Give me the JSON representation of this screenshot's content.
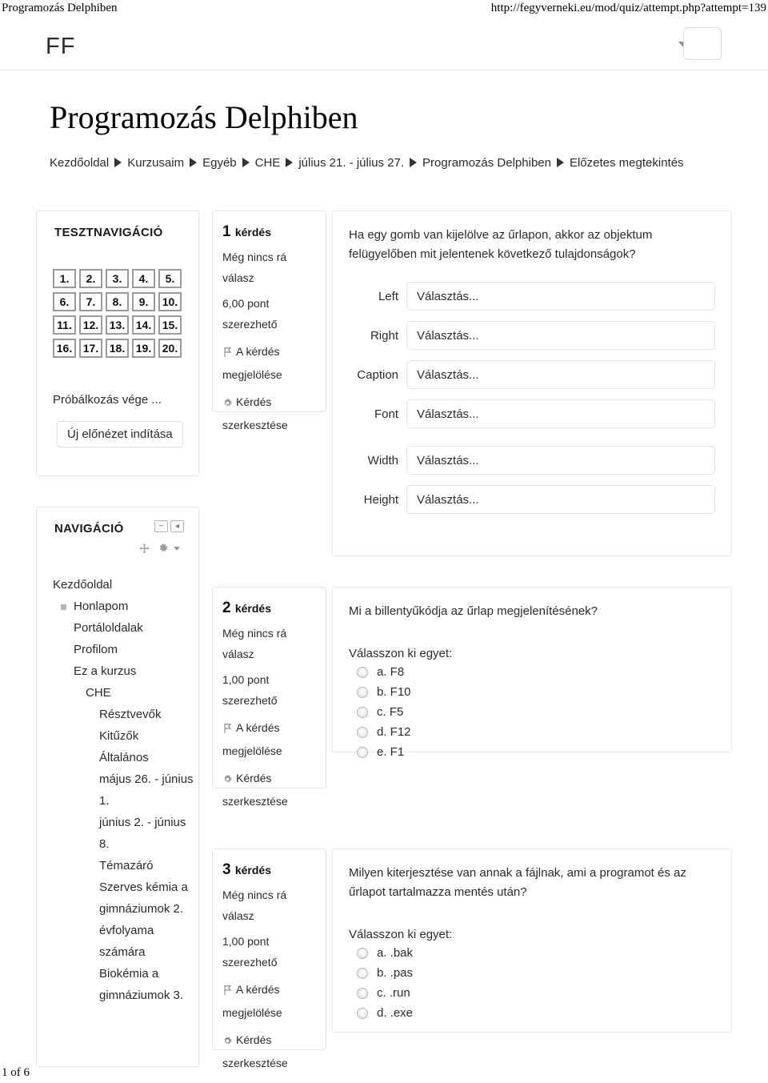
{
  "print_header": {
    "left": "Programozás Delphiben",
    "right": "http://fegyverneki.eu/mod/quiz/attempt.php?attempt=139"
  },
  "topbar": {
    "logo": "FF",
    "caret_icon": "chevron-down-icon",
    "blank_button_label": ""
  },
  "page_title": "Programozás Delphiben",
  "breadcrumb": {
    "items": [
      "Kezdőoldal",
      "Kurzusaim",
      "Egyéb",
      "CHE",
      "július 21. - július 27.",
      "Programozás Delphiben",
      "Előzetes megtekintés"
    ]
  },
  "quiz_nav": {
    "title": "TESZTNAVIGÁCIÓ",
    "boxes": [
      [
        "1.",
        "2.",
        "3.",
        "4.",
        "5."
      ],
      [
        "6.",
        "7.",
        "8.",
        "9.",
        "10."
      ],
      [
        "11.",
        "12.",
        "13.",
        "14.",
        "15."
      ],
      [
        "16.",
        "17.",
        "18.",
        "19.",
        "20."
      ]
    ],
    "attempt_end": "Próbálkozás vége ...",
    "new_preview_button": "Új előnézet indítása"
  },
  "nav_block": {
    "title": "NAVIGÁCIÓ",
    "header_icons": [
      "minimize-icon",
      "dock-left-icon"
    ],
    "tool_icons": [
      "move-icon",
      "gear-icon",
      "chevron-down-icon"
    ],
    "items": [
      {
        "label": "Kezdőoldal",
        "level": 0,
        "bullet": false
      },
      {
        "label": "Honlapom",
        "level": 1,
        "bullet": true
      },
      {
        "label": "Portáloldalak",
        "level": 1,
        "bullet": false
      },
      {
        "label": "Profilom",
        "level": 1,
        "bullet": false
      },
      {
        "label": "Ez a kurzus",
        "level": 1,
        "bullet": false
      },
      {
        "label": "CHE",
        "level": 2,
        "bullet": false
      },
      {
        "label": "Résztvevők",
        "level": 3,
        "bullet": false
      },
      {
        "label": "Kitűzők",
        "level": 3,
        "bullet": false
      },
      {
        "label": "Általános",
        "level": 3,
        "bullet": false
      },
      {
        "label": "május 26. - június 1.",
        "level": 3,
        "bullet": false
      },
      {
        "label": "június 2. - június 8.",
        "level": 3,
        "bullet": false
      },
      {
        "label": "Témazáró",
        "level": 3,
        "bullet": false
      },
      {
        "label": "Szerves kémia a gimnáziumok 2. évfolyama számára",
        "level": 3,
        "bullet": false
      },
      {
        "label": "Biokémia a gimnáziumok 3.",
        "level": 3,
        "bullet": false
      }
    ]
  },
  "questions": [
    {
      "number": "1",
      "number_suffix": "kérdés",
      "status": "Még nincs rá válasz",
      "points": "6,00 pont szerezhető",
      "flag_link": "A kérdés megjelölése",
      "edit_link": "Kérdés szerkesztése",
      "text": "Ha egy gomb van kijelölve az űrlapon, akkor az objektum felügyelőben mit jelentenek következő tulajdonságok?",
      "type": "matching",
      "matches": [
        {
          "label": "Left",
          "value": "Választás..."
        },
        {
          "label": "Right",
          "value": "Választás..."
        },
        {
          "label": "Caption",
          "value": "Választás..."
        },
        {
          "label": "Font",
          "value": "Választás..."
        },
        {
          "label": "Width",
          "value": "Választás..."
        },
        {
          "label": "Height",
          "value": "Választás..."
        }
      ]
    },
    {
      "number": "2",
      "number_suffix": "kérdés",
      "status": "Még nincs rá válasz",
      "points": "1,00 pont szerezhető",
      "flag_link": "A kérdés megjelölése",
      "edit_link": "Kérdés szerkesztése",
      "text": "Mi a billentyűkódja az űrlap megjelenítésének?",
      "type": "multichoice",
      "choose_label": "Válasszon ki egyet:",
      "answers": [
        "a. F8",
        "b. F10",
        "c. F5",
        "d. F12",
        "e. F1"
      ]
    },
    {
      "number": "3",
      "number_suffix": "kérdés",
      "status": "Még nincs rá válasz",
      "points": "1,00 pont szerezhető",
      "flag_link": "A kérdés megjelölése",
      "edit_link": "Kérdés szerkesztése",
      "text": "Milyen kiterjesztése van annak a fájlnak, ami a programot és az űrlapot tartalmazza mentés után?",
      "type": "multichoice",
      "choose_label": "Válasszon ki egyet:",
      "answers": [
        "a. .bak",
        "b. .pas",
        "c. .run",
        "d. .exe"
      ]
    }
  ],
  "footer": {
    "page": "1 of 6"
  },
  "colors": {
    "text": "#2b2b2b",
    "border": "#e6e6e6",
    "box_border": "#9a9a9a",
    "icon_gray": "#9a9a9a"
  }
}
